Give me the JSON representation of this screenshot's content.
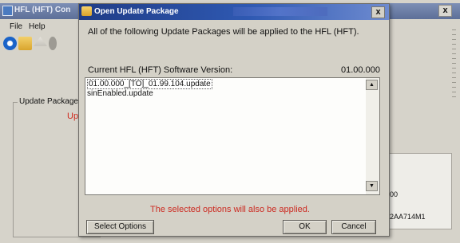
{
  "background_window": {
    "title": "HFL (HFT) Con",
    "menu": {
      "file": "File",
      "help": "Help"
    },
    "group_label": "Update Package",
    "red_text": "Upo",
    "right_values": [
      "00",
      "2AA714M1"
    ]
  },
  "dialog": {
    "title": "Open Update Package",
    "message": "All of the following Update Packages will be applied to the HFL (HFT).",
    "version_label": "Current HFL (HFT) Software Version:",
    "version_value": "01.00.000",
    "packages": [
      "01.00.000_[TO]_01.99.104.update",
      "sinEnabled.update"
    ],
    "note": "The selected options will also be applied.",
    "buttons": {
      "select_options": "Select Options",
      "ok": "OK",
      "cancel": "Cancel"
    },
    "close_glyph": "x"
  },
  "colors": {
    "dialog_title_bar": "#2f59b2",
    "note_red": "#cc2b22",
    "window_face": "#d4d1c7"
  },
  "icons": [
    "bluetooth-icon",
    "folder-icon",
    "eject-icon",
    "close-icon",
    "scroll-up-icon",
    "scroll-down-icon"
  ]
}
